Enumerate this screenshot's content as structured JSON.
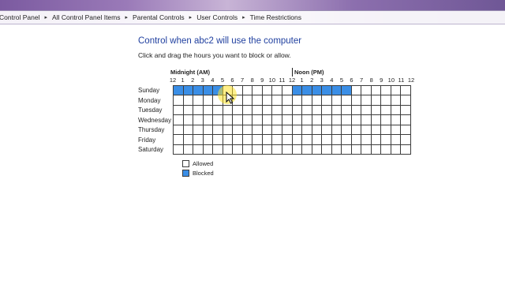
{
  "breadcrumb": [
    "Control Panel",
    "All Control Panel Items",
    "Parental Controls",
    "User Controls",
    "Time Restrictions"
  ],
  "heading": "Control when abc2 will use the computer",
  "instruction": "Click and drag the hours you want to block or allow.",
  "periods": {
    "am": "Midnight (AM)",
    "pm": "Noon (PM)"
  },
  "hour_labels": [
    "12",
    "1",
    "2",
    "3",
    "4",
    "5",
    "6",
    "7",
    "8",
    "9",
    "10",
    "11",
    "12",
    "1",
    "2",
    "3",
    "4",
    "5",
    "6",
    "7",
    "8",
    "9",
    "10",
    "11",
    "12"
  ],
  "days": [
    {
      "label": "Sunday",
      "blocked_hours": [
        0,
        1,
        2,
        3,
        4,
        12,
        13,
        14,
        15,
        16,
        17
      ]
    },
    {
      "label": "Monday",
      "blocked_hours": []
    },
    {
      "label": "Tuesday",
      "blocked_hours": []
    },
    {
      "label": "Wednesday",
      "blocked_hours": []
    },
    {
      "label": "Thursday",
      "blocked_hours": []
    },
    {
      "label": "Friday",
      "blocked_hours": []
    },
    {
      "label": "Saturday",
      "blocked_hours": []
    }
  ],
  "legend": {
    "allowed": "Allowed",
    "blocked": "Blocked"
  },
  "colors": {
    "blocked": "#3a8ee6",
    "heading": "#1f3f9f"
  }
}
